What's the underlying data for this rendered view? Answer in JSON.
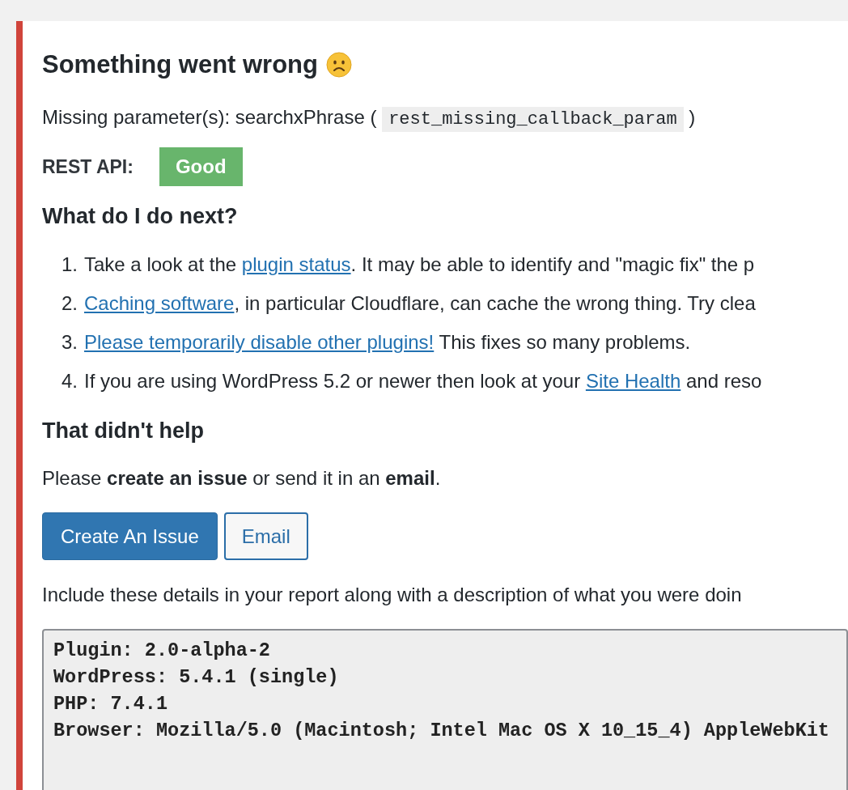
{
  "title": "Something went wrong",
  "error": {
    "message": "Missing parameter(s): searchxPhrase (",
    "code": "rest_missing_callback_param",
    "close": ")"
  },
  "rest_api": {
    "label": "REST API:",
    "status": "Good"
  },
  "next_heading": "What do I do next?",
  "steps": [
    {
      "number": "1.",
      "segments": [
        {
          "text": "Take a look at the ",
          "link": false
        },
        {
          "text": "plugin status",
          "link": true
        },
        {
          "text": ". It may be able to identify and \"magic fix\" the p",
          "link": false
        }
      ]
    },
    {
      "number": "2.",
      "segments": [
        {
          "text": "Caching software",
          "link": true
        },
        {
          "text": ", in particular Cloudflare, can cache the wrong thing. Try clea",
          "link": false
        }
      ]
    },
    {
      "number": "3.",
      "segments": [
        {
          "text": "Please temporarily disable other plugins!",
          "link": true
        },
        {
          "text": " This fixes so many problems.",
          "link": false
        }
      ]
    },
    {
      "number": "4.",
      "segments": [
        {
          "text": "If you are using WordPress 5.2 or newer then look at your ",
          "link": false
        },
        {
          "text": "Site Health",
          "link": true
        },
        {
          "text": " and reso",
          "link": false
        }
      ]
    }
  ],
  "help_heading": "That didn't help",
  "help_text": "Please **create an issue** or send it in an **email**.",
  "buttons": [
    {
      "label": "Create An Issue",
      "kind": "primary"
    },
    {
      "label": "Email",
      "kind": "secondary"
    }
  ],
  "details_intro": "Include these details in your report along with a description of what you were doin",
  "details": [
    "Plugin: 2.0-alpha-2",
    "WordPress: 5.4.1 (single)",
    "PHP: 7.4.1",
    "Browser: Mozilla/5.0 (Macintosh; Intel Mac OS X 10_15_4) AppleWebKit"
  ]
}
